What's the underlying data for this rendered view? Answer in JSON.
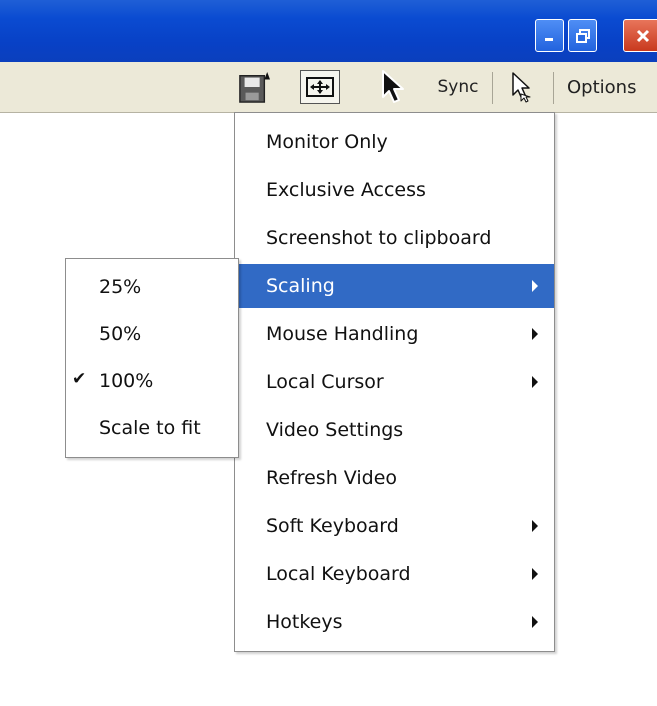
{
  "toolbar": {
    "sync_label": "Sync",
    "options_label": "Options",
    "icons": [
      "save-icon",
      "fit-screen-icon",
      "mouse-cursor-icon",
      "cursor-outline-icon"
    ]
  },
  "main_menu": {
    "items": [
      {
        "label": "Monitor Only",
        "submenu": false
      },
      {
        "label": "Exclusive Access",
        "submenu": false
      },
      {
        "label": "Screenshot to clipboard",
        "submenu": false
      },
      {
        "label": "Scaling",
        "submenu": true,
        "highlighted": true
      },
      {
        "label": "Mouse Handling",
        "submenu": true
      },
      {
        "label": "Local Cursor",
        "submenu": true
      },
      {
        "label": "Video Settings",
        "submenu": false
      },
      {
        "label": "Refresh Video",
        "submenu": false
      },
      {
        "label": "Soft Keyboard",
        "submenu": true
      },
      {
        "label": "Local Keyboard",
        "submenu": true
      },
      {
        "label": "Hotkeys",
        "submenu": true
      }
    ]
  },
  "scaling_submenu": {
    "items": [
      {
        "label": "25%",
        "checked": false
      },
      {
        "label": "50%",
        "checked": false
      },
      {
        "label": "100%",
        "checked": true
      },
      {
        "label": "Scale to fit",
        "checked": false
      }
    ],
    "check_mark": "✔"
  },
  "colors": {
    "titlebar": "#0a4bd1",
    "toolbar": "#ece9d8",
    "menu_highlight": "#316ac5"
  }
}
